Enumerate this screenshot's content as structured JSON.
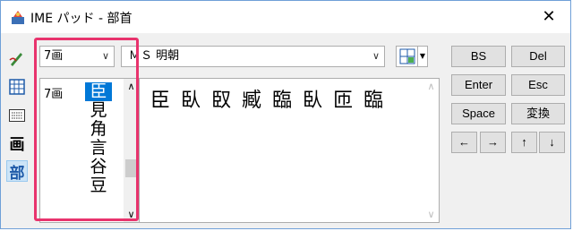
{
  "window": {
    "title": "IME パッド - 部首",
    "close_glyph": "✕"
  },
  "left_toolbar": {
    "tools": [
      {
        "name": "handwriting-icon"
      },
      {
        "name": "character-list-icon"
      },
      {
        "name": "soft-keyboard-icon"
      },
      {
        "name": "total-strokes",
        "label": "画"
      },
      {
        "name": "radical",
        "label": "部",
        "active": true
      }
    ]
  },
  "stroke_select": {
    "value": "7画"
  },
  "font_select": {
    "value": "ＭＳ 明朝"
  },
  "radical_list": {
    "stroke_label": "7画",
    "radicals": [
      "臣",
      "見",
      "角",
      "言",
      "谷",
      "豆"
    ],
    "selected_index": 0
  },
  "characters": [
    "臣",
    "臥",
    "臤",
    "臧",
    "臨",
    "臥",
    "匝",
    "臨"
  ],
  "keys": {
    "bs": "BS",
    "del": "Del",
    "enter": "Enter",
    "esc": "Esc",
    "space": "Space",
    "convert": "変換",
    "left": "←",
    "right": "→",
    "up": "↑",
    "down": "↓"
  },
  "colors": {
    "highlight_box": "#e8336d",
    "selection": "#0078d7"
  }
}
